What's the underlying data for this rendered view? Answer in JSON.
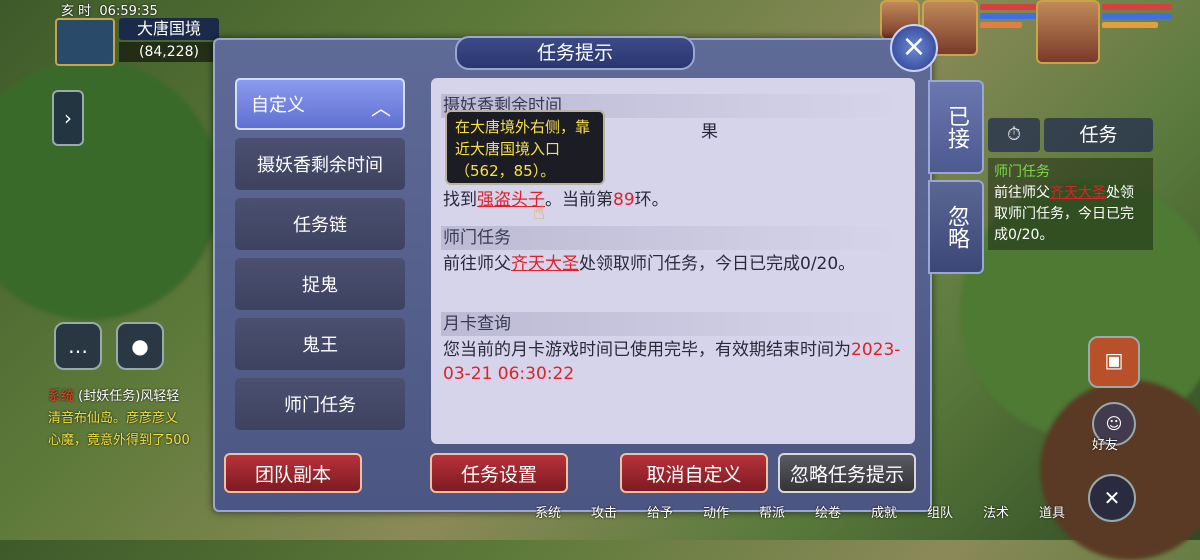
{
  "hud": {
    "time_label": "亥 时",
    "clock": "06:59:35",
    "map_name": "大唐国境",
    "coords": "(84,228)"
  },
  "panel": {
    "title": "任务提示",
    "close_icon": "close-icon",
    "menu": [
      {
        "label": "自定义",
        "active": true
      },
      {
        "label": "摄妖香剩余时间"
      },
      {
        "label": "任务链"
      },
      {
        "label": "捉鬼"
      },
      {
        "label": "鬼王"
      },
      {
        "label": "师门任务"
      }
    ],
    "side_tabs": [
      "已接",
      "忽略"
    ],
    "buttons": {
      "team_dungeon": "团队副本",
      "task_settings": "任务设置",
      "cancel_custom": "取消自定义",
      "ignore_tips": "忽略任务提示"
    }
  },
  "content": {
    "sec1_head": "摄妖香剩余时间",
    "sec1_fragment": "果",
    "sec2_body_a": "找到",
    "sec2_link": "强盗头子",
    "sec2_body_b": "。当前第",
    "sec2_count": "89",
    "sec2_body_c": "环。",
    "sec3_head": "师门任务",
    "sec3_body_a": "前往师父",
    "sec3_link": "齐天大圣",
    "sec3_body_b": "处领取师门任务，今日已完成0/20。",
    "sec4_head": "月卡查询",
    "sec4_body": "您当前的月卡游戏时间已使用完毕，有效期结束时间为",
    "sec4_date": "2023-03-21 06:30:22"
  },
  "tooltip": {
    "text": "在大唐境外右侧，靠近大唐国境入口（562，85）。"
  },
  "tracker": {
    "label": "任务",
    "title": "师门任务",
    "body_a": "前往师父",
    "body_link": "齐天大圣",
    "body_b": "处领取师门任务，今日已完成0/20。"
  },
  "chat": {
    "line1_tag": "系统",
    "line1_text": "(封妖任务)风轻轻",
    "line2_text": "清音布仙岛。彦彦彦乂",
    "line3_text": "心魔，竟意外得到了500"
  },
  "bottom_bar": [
    "系统",
    "攻击",
    "给予",
    "动作",
    "帮派",
    "绘卷",
    "成就",
    "组队",
    "法术",
    "道具"
  ],
  "right_icons": {
    "friends": "好友"
  },
  "colors": {
    "link_red": "#e0202a",
    "tooltip_yellow": "#f8e048",
    "tracker_green": "#7adc4a"
  }
}
